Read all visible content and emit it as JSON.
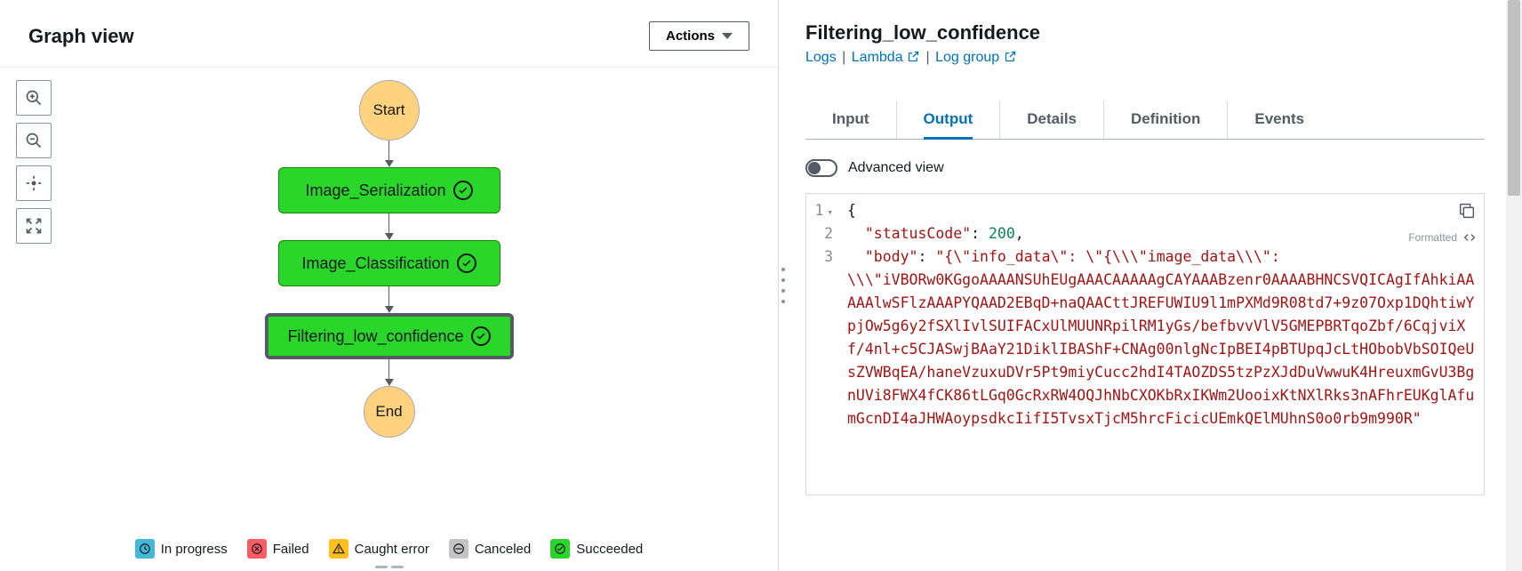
{
  "left": {
    "title": "Graph view",
    "actions_label": "Actions",
    "nodes": {
      "start": "Start",
      "n1": "Image_Serialization",
      "n2": "Image_Classification",
      "n3": "Filtering_low_confidence",
      "end": "End"
    },
    "legend": {
      "in_progress": "In progress",
      "failed": "Failed",
      "caught_error": "Caught error",
      "canceled": "Canceled",
      "succeeded": "Succeeded"
    }
  },
  "right": {
    "title": "Filtering_low_confidence",
    "links": {
      "logs": "Logs",
      "lambda": "Lambda",
      "log_group": "Log group"
    },
    "tabs": {
      "input": "Input",
      "output": "Output",
      "details": "Details",
      "definition": "Definition",
      "events": "Events"
    },
    "advanced_label": "Advanced view",
    "formatted_label": "Formatted",
    "code": {
      "line1": "{",
      "line2_key": "\"statusCode\"",
      "line2_val": "200",
      "line3_key": "\"body\"",
      "line3_head": "\"{\\\"info_data\\\": \\\"{\\\\\\\"image_data\\\\\\\":",
      "body_rest": "\\\\\\\"iVBORw0KGgoAAAANSUhEUgAAACAAAAAgCAYAAABzenr0AAAABHNCSVQICAgIfAhkiAAAAAlwSFlzAAAPYQAAD2EBqD+naQAACttJREFUWIU9l1mPXMd9R08td7+9z07Oxp1DQhtiwYpjOw5g6y2fSXlIvlSUIFACxUlMUUNRpilRM1yGs/befbvvVlV5GMEPBRTqoZbf/6CqjviXf/4nl+c5CJASwjBAaY21DiklIBAShF+CNAg00nlgNcIpBEI4pBTUpqJcLtHObobVbSOIQeUsZVWBqEA/haneVzuxuDVr5Pt9miyCucc2hdI4TAOZDS5tzPzXJdDuVwwuK4HreuxmGvU3BgnUVi8FWX4fCK86tLGq0GcRxRW4OQJhNbCXOKbRxIKWm2UooixKtNXlRks3nAFhrEUKglAfumGcnDI4aJHWAoypsdkcIifI5TvsxTjcM5hrcFicicUEmkQElMUhnS0o0rb9m990R\""
    },
    "gutter": [
      "1",
      "2",
      "3"
    ]
  }
}
